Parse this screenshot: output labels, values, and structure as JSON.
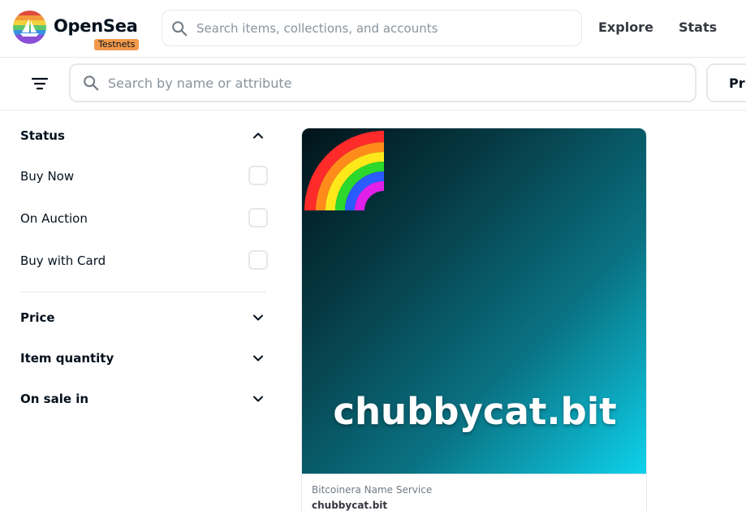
{
  "brand": {
    "name": "OpenSea",
    "badge": "Testnets"
  },
  "top_search": {
    "placeholder": "Search items, collections, and accounts",
    "icon": "search-icon"
  },
  "nav": {
    "explore": "Explore",
    "stats": "Stats"
  },
  "item_search": {
    "placeholder": "Search by name or attribute",
    "icon": "search-icon"
  },
  "sort_button": {
    "label": "Pri"
  },
  "sidebar": {
    "status": {
      "title": "Status",
      "expanded": true,
      "options": [
        {
          "label": "Buy Now",
          "checked": false
        },
        {
          "label": "On Auction",
          "checked": false
        },
        {
          "label": "Buy with Card",
          "checked": false
        }
      ]
    },
    "sections": [
      {
        "title": "Price",
        "expanded": false
      },
      {
        "title": "Item quantity",
        "expanded": false
      },
      {
        "title": "On sale in",
        "expanded": false
      }
    ]
  },
  "card": {
    "image_text": "chubbycat.bit",
    "collection": "Bitcoinera Name Service",
    "name": "chubbycat.bit"
  },
  "colors": {
    "text_primary": "#04111d",
    "border": "#e5e8eb",
    "badge": "#f2994a",
    "card_gradient_start": "#01141a",
    "card_gradient_end": "#0ed2ec"
  }
}
